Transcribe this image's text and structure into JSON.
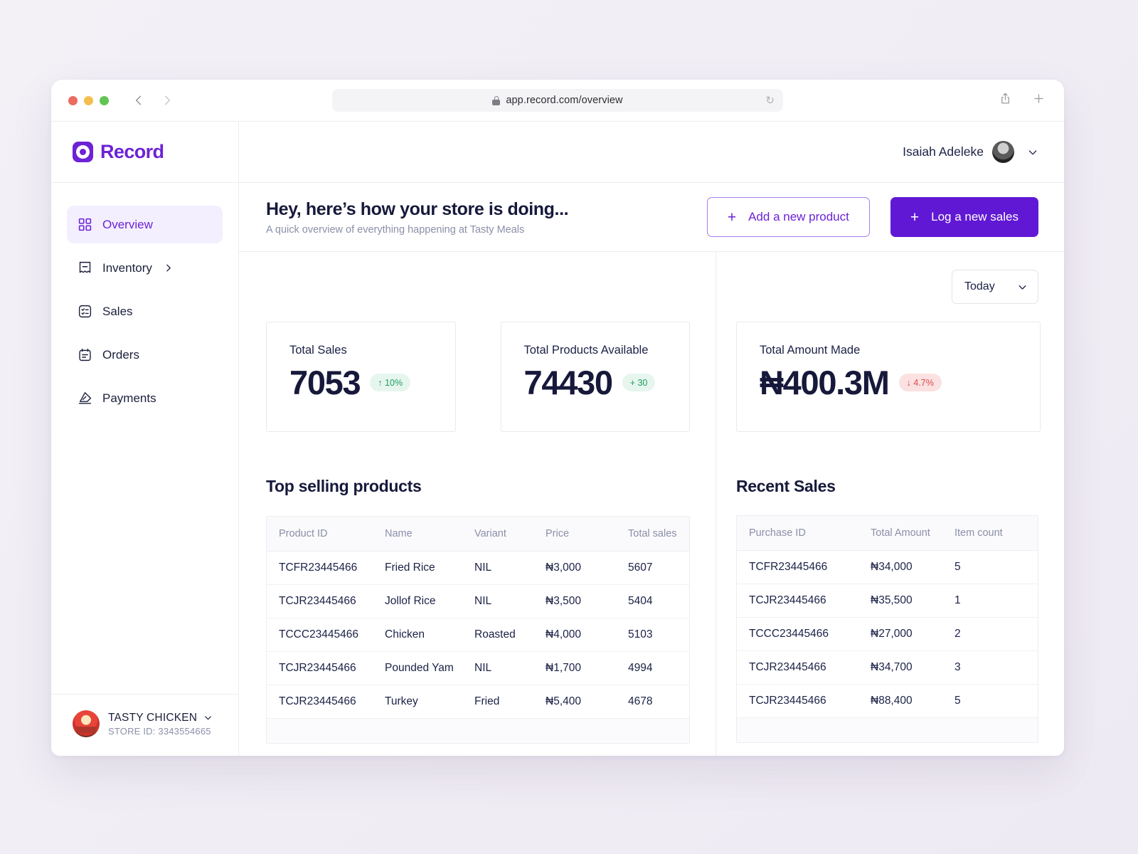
{
  "browser": {
    "url": "app.record.com/overview",
    "back_icon": "chevron-left-icon",
    "forward_icon": "chevron-right-icon",
    "reload_glyph": "↻",
    "share_icon": "share-icon",
    "newtab_icon": "plus-icon"
  },
  "brand": {
    "name": "Record"
  },
  "sidebar": {
    "items": [
      {
        "label": "Overview",
        "icon": "grid-icon",
        "active": true,
        "has_chevron": false
      },
      {
        "label": "Inventory",
        "icon": "inventory-icon",
        "active": false,
        "has_chevron": true
      },
      {
        "label": "Sales",
        "icon": "sales-icon",
        "active": false,
        "has_chevron": false
      },
      {
        "label": "Orders",
        "icon": "orders-icon",
        "active": false,
        "has_chevron": false
      },
      {
        "label": "Payments",
        "icon": "payments-icon",
        "active": false,
        "has_chevron": false
      }
    ],
    "store": {
      "name": "TASTY CHICKEN",
      "id_label": "STORE  ID: 3343554665"
    }
  },
  "topbar": {
    "user_name": "Isaiah Adeleke",
    "avatar": "user-avatar",
    "caret_icon": "chevron-down-icon"
  },
  "pagehead": {
    "title": "Hey, here’s how your store is doing...",
    "subtitle": "A quick overview of everything happening at Tasty Meals",
    "add_product_label": "Add a new product",
    "log_sales_label": "Log a new sales",
    "plus_glyph": "+"
  },
  "filter": {
    "selected": "Today",
    "caret_icon": "chevron-down-icon"
  },
  "stats": [
    {
      "label": "Total Sales",
      "value": "7053",
      "badge": "↑ 10%",
      "badge_type": "up"
    },
    {
      "label": "Total Products Available",
      "value": "74430",
      "badge": "+ 30",
      "badge_type": "neutral"
    },
    {
      "label": "Total Amount Made",
      "value": "₦400.3M",
      "badge": "↓ 4.7%",
      "badge_type": "down"
    }
  ],
  "top_products": {
    "title": "Top selling products",
    "columns": [
      "Product ID",
      "Name",
      "Variant",
      "Price",
      "Total sales"
    ],
    "rows": [
      [
        "TCFR23445466",
        "Fried Rice",
        "NIL",
        "₦3,000",
        "5607"
      ],
      [
        "TCJR23445466",
        "Jollof Rice",
        "NIL",
        "₦3,500",
        "5404"
      ],
      [
        "TCCC23445466",
        "Chicken",
        "Roasted",
        "₦4,000",
        "5103"
      ],
      [
        "TCJR23445466",
        "Pounded Yam",
        "NIL",
        "₦1,700",
        "4994"
      ],
      [
        "TCJR23445466",
        "Turkey",
        "Fried",
        "₦5,400",
        "4678"
      ]
    ]
  },
  "recent_sales": {
    "title": "Recent Sales",
    "columns": [
      "Purchase ID",
      "Total Amount",
      "Item count"
    ],
    "rows": [
      [
        "TCFR23445466",
        "₦34,000",
        "5"
      ],
      [
        "TCJR23445466",
        "₦35,500",
        "1"
      ],
      [
        "TCCC23445466",
        "₦27,000",
        "2"
      ],
      [
        "TCJR23445466",
        "₦34,700",
        "3"
      ],
      [
        "TCJR23445466",
        "₦88,400",
        "5"
      ]
    ]
  },
  "colors": {
    "brand_purple": "#6d22d6",
    "primary_button": "#6118d4",
    "active_nav_bg": "#f3efff",
    "text_dark": "#17193b",
    "text_muted": "#8b8fa8",
    "badge_up_bg": "#e6f6ee",
    "badge_up_text": "#1f9d62",
    "badge_down_bg": "#fbe1e1",
    "badge_down_text": "#dc4b4b"
  }
}
